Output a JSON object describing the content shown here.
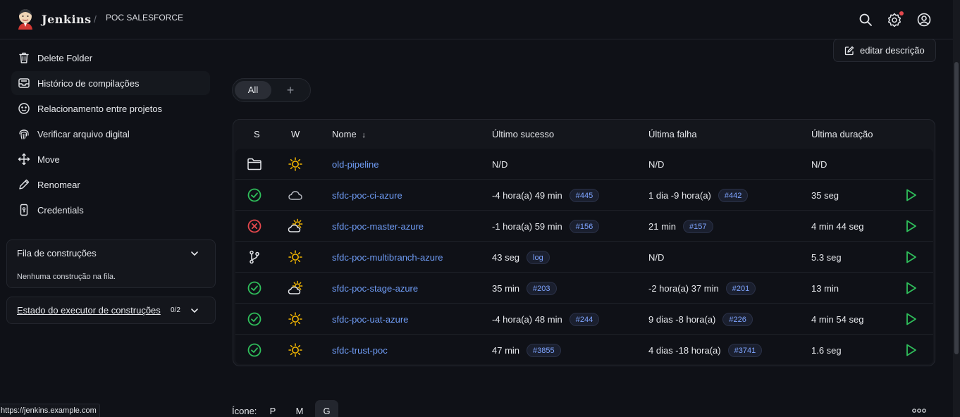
{
  "header": {
    "brand": "Jenkins",
    "separator": "/",
    "breadcrumb": "POC SALESFORCE",
    "icons": [
      "search-icon",
      "gear-icon",
      "account-icon"
    ],
    "notification_color": "#e5484d"
  },
  "sidebar": {
    "items": [
      {
        "label": "Delete Folder",
        "icon": "trash-icon"
      },
      {
        "label": "Histórico de compilações",
        "icon": "inbox-icon"
      },
      {
        "label": "Relacionamento entre projetos",
        "icon": "relations-icon"
      },
      {
        "label": "Verificar arquivo digital",
        "icon": "fingerprint-icon"
      },
      {
        "label": "Move",
        "icon": "move-icon"
      },
      {
        "label": "Renomear",
        "icon": "pencil-icon"
      },
      {
        "label": "Credentials",
        "icon": "phone-key-icon"
      }
    ],
    "build_queue": {
      "title": "Fila de construções",
      "empty_text": "Nenhuma construção na fila."
    },
    "executor_status": {
      "title": "Estado do executor de construções",
      "count": "0/2"
    }
  },
  "edit_description": {
    "label": "editar descrição"
  },
  "tabs": {
    "active": "All",
    "add": "+"
  },
  "table": {
    "headers": {
      "s": "S",
      "w": "W",
      "name": "Nome",
      "sort_indicator": "↓",
      "last_success": "Último sucesso",
      "last_failure": "Última falha",
      "last_duration": "Última duração"
    },
    "rows": [
      {
        "status": "folder",
        "weather": "sunny",
        "name": "old-pipeline",
        "last_success": "N/D",
        "success_badge": "",
        "last_failure": "N/D",
        "failure_badge": "",
        "duration": "N/D",
        "runnable": false
      },
      {
        "status": "success",
        "weather": "cloudy",
        "name": "sfdc-poc-ci-azure",
        "last_success": "-4 hora(a) 49 min",
        "success_badge": "#445",
        "last_failure": "1 dia -9 hora(a)",
        "failure_badge": "#442",
        "duration": "35 seg",
        "runnable": true
      },
      {
        "status": "failed",
        "weather": "partly-cloudy",
        "name": "sfdc-poc-master-azure",
        "last_success": "-1 hora(a) 59 min",
        "success_badge": "#156",
        "last_failure": "21 min",
        "failure_badge": "#157",
        "duration": "4 min 44 seg",
        "runnable": true
      },
      {
        "status": "multibranch",
        "weather": "sunny",
        "name": "sfdc-poc-multibranch-azure",
        "last_success": "43 seg",
        "success_badge": "log",
        "last_failure": "N/D",
        "failure_badge": "",
        "duration": "5.3 seg",
        "runnable": true
      },
      {
        "status": "success",
        "weather": "partly-cloudy",
        "name": "sfdc-poc-stage-azure",
        "last_success": "35 min",
        "success_badge": "#203",
        "last_failure": "-2 hora(a) 37 min",
        "failure_badge": "#201",
        "duration": "13 min",
        "runnable": true
      },
      {
        "status": "success",
        "weather": "sunny",
        "name": "sfdc-poc-uat-azure",
        "last_success": "-4 hora(a) 48 min",
        "success_badge": "#244",
        "last_failure": "9 dias -8 hora(a)",
        "failure_badge": "#226",
        "duration": "4 min 54 seg",
        "runnable": true
      },
      {
        "status": "success",
        "weather": "sunny",
        "name": "sfdc-trust-poc",
        "last_success": "47 min",
        "success_badge": "#3855",
        "last_failure": "4 dias -18 hora(a)",
        "failure_badge": "#3741",
        "duration": "1.6 seg",
        "runnable": true
      }
    ]
  },
  "footer": {
    "status_url": "https://jenkins.example.com",
    "icon_label": "Ícone:",
    "sizes": [
      "P",
      "M",
      "G"
    ],
    "selected_size": "G"
  },
  "colors": {
    "background": "#0f1117",
    "link": "#6f9cf5",
    "success": "#2fbf5b",
    "failure": "#e5484d",
    "sun": "#f5b800"
  }
}
